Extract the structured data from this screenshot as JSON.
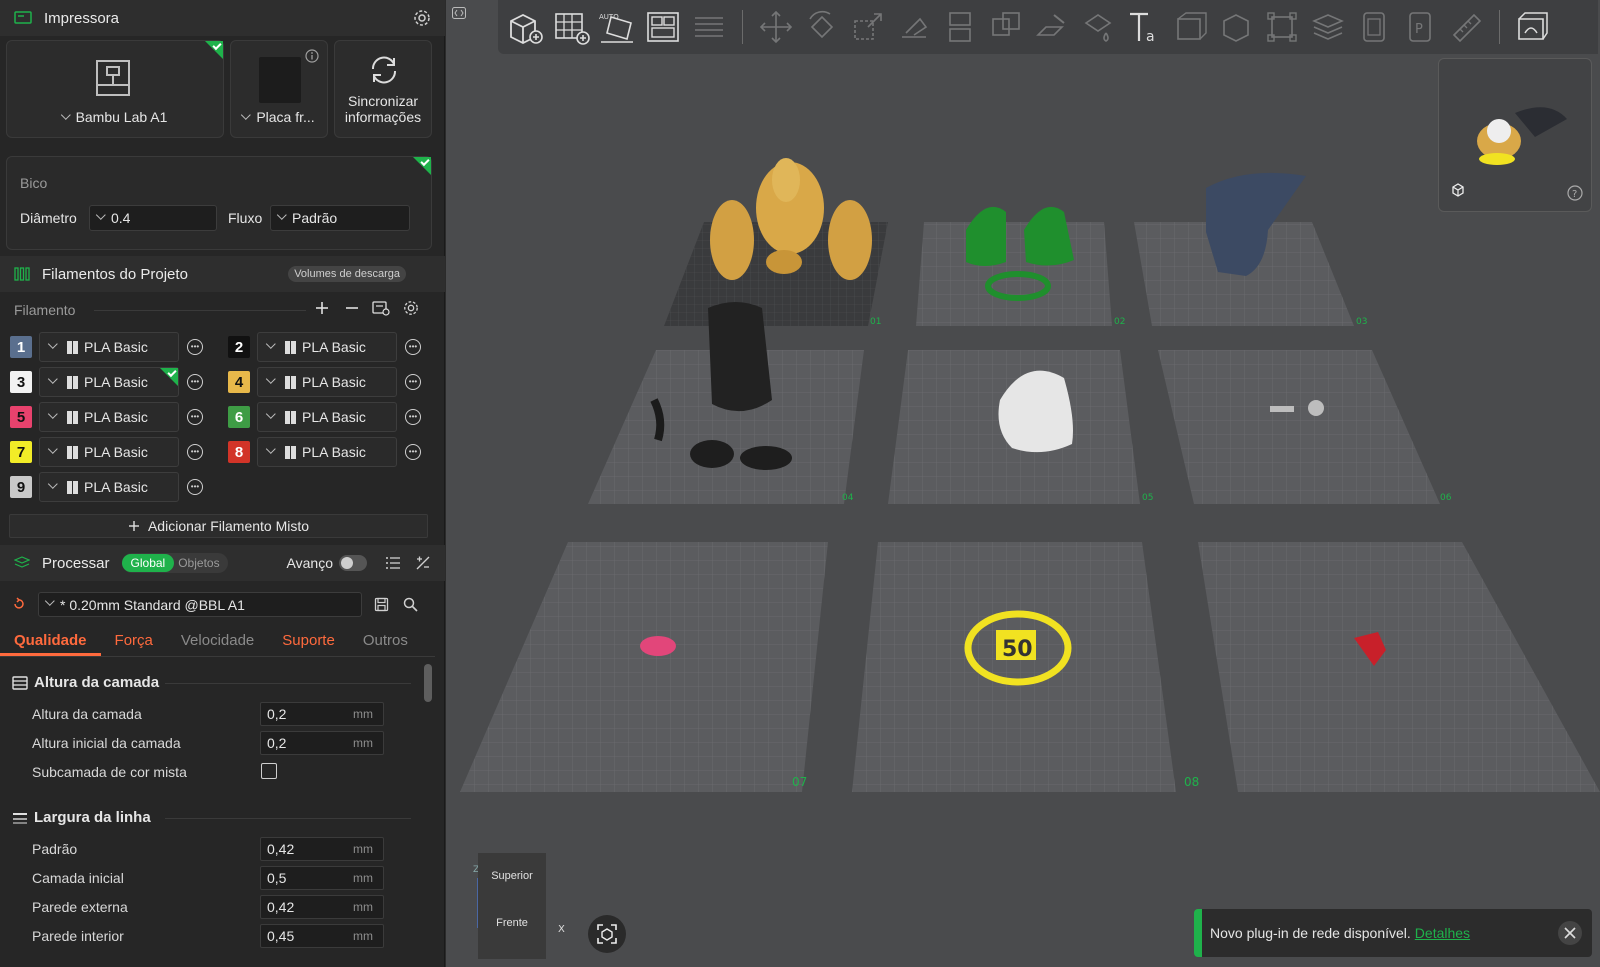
{
  "printer_section": {
    "title": "Impressora",
    "printer_name": "Bambu Lab A1",
    "plate_name": "Placa fr...",
    "sync_label_line1": "Sincronizar",
    "sync_label_line2": "informações"
  },
  "nozzle": {
    "title": "Bico",
    "diameter_label": "Diâmetro",
    "diameter_value": "0.4",
    "flow_label": "Fluxo",
    "flow_value": "Padrão"
  },
  "filaments": {
    "title": "Filamentos do Projeto",
    "purge_badge": "Volumes de descarga",
    "filament_label": "Filamento",
    "items": [
      {
        "num": "1",
        "color": "#5a6f8e",
        "text_color": "#ffffff",
        "name": "PLA Basic"
      },
      {
        "num": "2",
        "color": "#111111",
        "text_color": "#ffffff",
        "name": "PLA Basic"
      },
      {
        "num": "3",
        "color": "#f2f2f2",
        "text_color": "#111111",
        "name": "PLA Basic"
      },
      {
        "num": "4",
        "color": "#e8b84a",
        "text_color": "#111111",
        "name": "PLA Basic"
      },
      {
        "num": "5",
        "color": "#e8426d",
        "text_color": "#111111",
        "name": "PLA Basic"
      },
      {
        "num": "6",
        "color": "#3e9c45",
        "text_color": "#ffffff",
        "name": "PLA Basic"
      },
      {
        "num": "7",
        "color": "#f2ec27",
        "text_color": "#111111",
        "name": "PLA Basic"
      },
      {
        "num": "8",
        "color": "#d23428",
        "text_color": "#ffffff",
        "name": "PLA Basic"
      },
      {
        "num": "9",
        "color": "#c9c9c9",
        "text_color": "#111111",
        "name": "PLA Basic"
      }
    ],
    "add_mixed_label": "Adicionar Filamento Misto"
  },
  "process": {
    "title": "Processar",
    "toggle_global": "Global",
    "toggle_objects": "Objetos",
    "advanced_label": "Avanço",
    "preset": "* 0.20mm Standard @BBL A1",
    "tabs": [
      "Qualidade",
      "Força",
      "Velocidade",
      "Suporte",
      "Outros"
    ]
  },
  "layer_height": {
    "title": "Altura da camada",
    "rows": [
      {
        "label": "Altura da camada",
        "value": "0,2",
        "unit": "mm"
      },
      {
        "label": "Altura inicial da camada",
        "value": "0,2",
        "unit": "mm"
      }
    ],
    "mixed_sublayer_label": "Subcamada de cor mista"
  },
  "line_width": {
    "title": "Largura da linha",
    "rows": [
      {
        "label": "Padrão",
        "value": "0,42",
        "unit": "mm"
      },
      {
        "label": "Camada inicial",
        "value": "0,5",
        "unit": "mm"
      },
      {
        "label": "Parede externa",
        "value": "0,42",
        "unit": "mm"
      },
      {
        "label": "Parede interior",
        "value": "0,45",
        "unit": "mm"
      }
    ]
  },
  "viewport": {
    "plate_labels": [
      "01",
      "02",
      "03",
      "04",
      "05",
      "06",
      "07",
      "08"
    ],
    "viewcube_top": "Superior",
    "viewcube_front": "Frente",
    "axis_z": "Z",
    "axis_x": "X",
    "pendant_text": "50",
    "toast_text": "Novo plug-in de rede disponível.",
    "toast_link": "Detalhes"
  },
  "colors": {
    "accent_orange": "#ff6a3d",
    "accent_green": "#1fb24b"
  }
}
